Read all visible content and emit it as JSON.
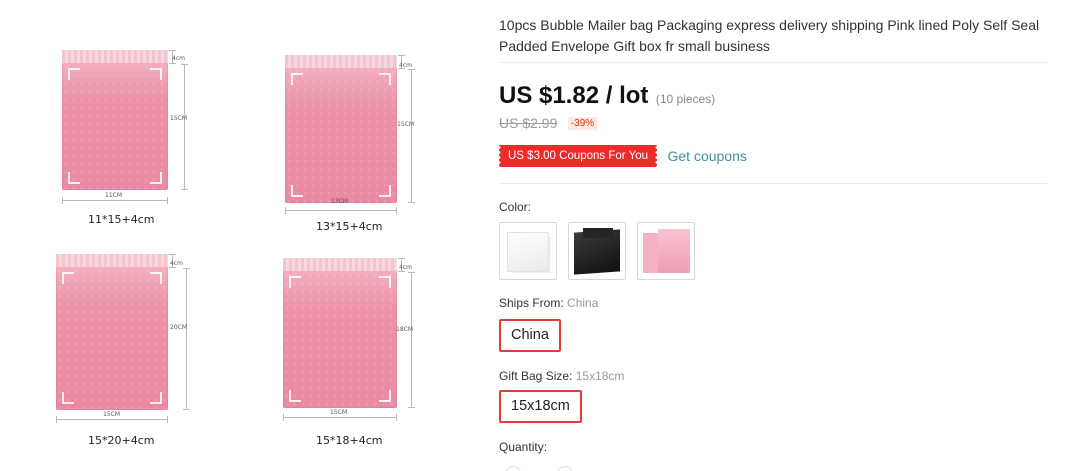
{
  "gallery": {
    "items": [
      {
        "caption": "11*15+4cm",
        "width_label": "11CM",
        "height_label": "15CM",
        "flap_label": "4cm"
      },
      {
        "caption": "13*15+4cm",
        "width_label": "13CM",
        "height_label": "15CM",
        "flap_label": "4cm"
      },
      {
        "caption": "15*20+4cm",
        "width_label": "15CM",
        "height_label": "20CM",
        "flap_label": "4cm"
      },
      {
        "caption": "15*18+4cm",
        "width_label": "15CM",
        "height_label": "18CM",
        "flap_label": "4cm"
      }
    ]
  },
  "product": {
    "title": "10pcs Bubble Mailer bag Packaging express delivery shipping Pink lined Poly Self Seal Padded Envelope Gift box fr small business",
    "price": "US $1.82 / lot",
    "pieces": "(10 pieces)",
    "old_price": "US $2.99",
    "discount": "-39%",
    "coupon_badge": "US $3.00 Coupons For You",
    "get_coupons": "Get coupons"
  },
  "options": {
    "color_label": "Color:",
    "color_swatches": [
      "white-mailer",
      "black-mailer",
      "pink-mailer"
    ],
    "ships_from_label": "Ships From:",
    "ships_from_selected": "China",
    "ships_from_option": "China",
    "gift_bag_label": "Gift Bag Size:",
    "gift_bag_selected": "15x18cm",
    "gift_bag_option": "15x18cm",
    "quantity_label": "Quantity:"
  },
  "colors": {
    "accent_red": "#e33c3c",
    "coupon_red": "#ed2b2b",
    "link_teal": "#3e8fa0",
    "bag_pink": "#ec91a8"
  }
}
